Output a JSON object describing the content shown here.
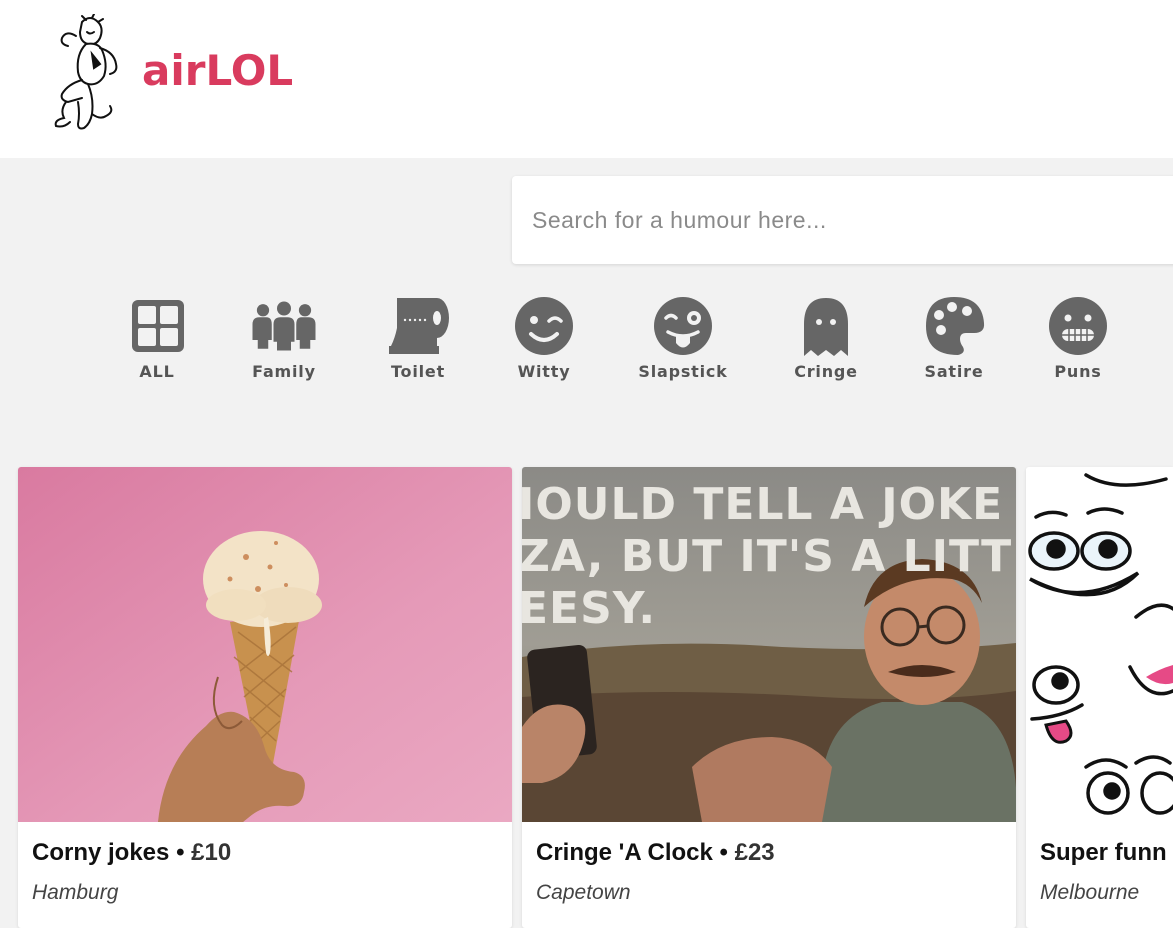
{
  "brand": {
    "name": "airLOL",
    "accent_color": "#d93b5e"
  },
  "search": {
    "placeholder": "Search for a humour here...",
    "value": ""
  },
  "categories": [
    {
      "label": "ALL",
      "icon": "grid-icon"
    },
    {
      "label": "Family",
      "icon": "people-group-icon"
    },
    {
      "label": "Toilet",
      "icon": "toilet-paper-icon"
    },
    {
      "label": "Witty",
      "icon": "wink-face-icon"
    },
    {
      "label": "Slapstick",
      "icon": "tongue-wink-face-icon"
    },
    {
      "label": "Cringe",
      "icon": "ghost-icon"
    },
    {
      "label": "Satire",
      "icon": "palette-icon"
    },
    {
      "label": "Puns",
      "icon": "grimace-face-icon"
    }
  ],
  "listings": [
    {
      "title": "Corny jokes",
      "separator": "•",
      "price": "£10",
      "location": "Hamburg",
      "image": "ice-cream-cone-photo"
    },
    {
      "title": "Cringe 'A Clock",
      "separator": "•",
      "price": "£23",
      "location": "Capetown",
      "image": "cheesy-pizza-joke-meme",
      "caption_lines": [
        "IOULD TELL A JOKE ABO",
        "ZA, BUT IT'S A LITTLE",
        "EESY."
      ]
    },
    {
      "title": "Super funn",
      "separator": "",
      "price": "",
      "location": "Melbourne",
      "image": "cartoon-faces-pattern"
    }
  ]
}
